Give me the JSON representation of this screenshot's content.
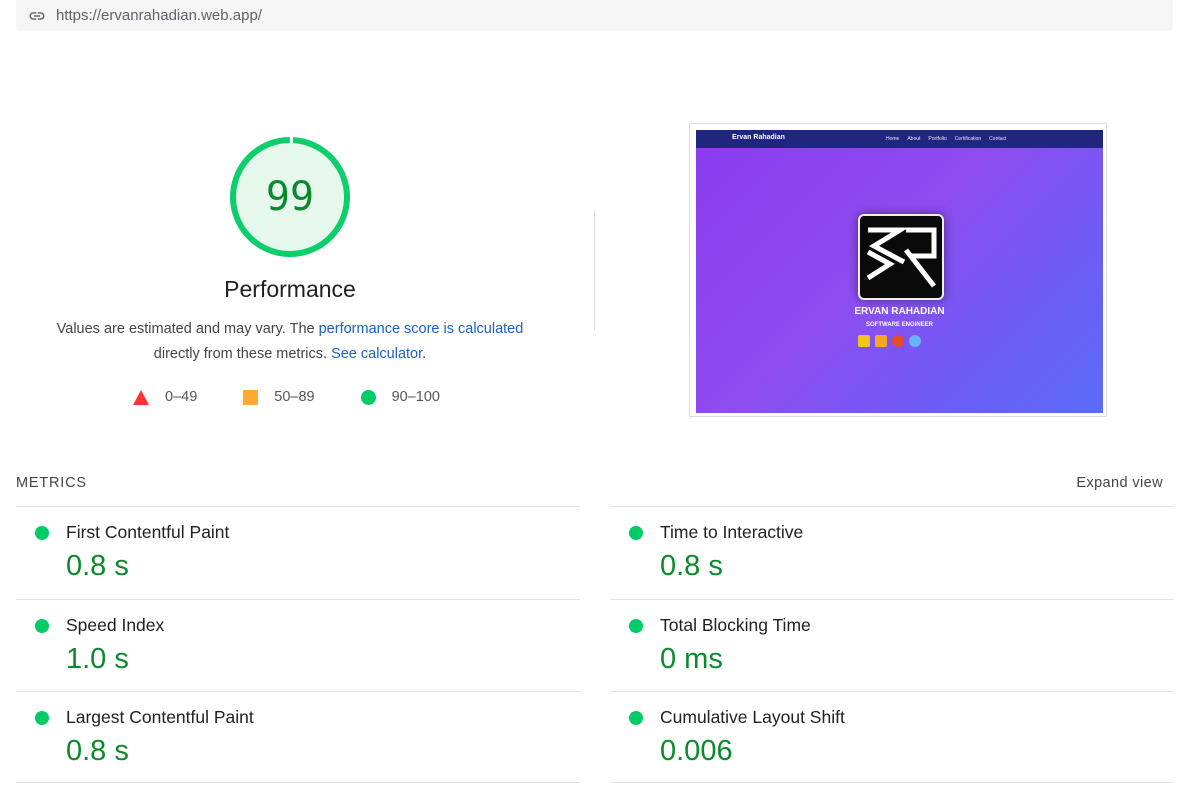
{
  "url_bar": {
    "icon": "link-icon",
    "url": "https://ervanrahadian.web.app/"
  },
  "gauge": {
    "score": "99",
    "score_fraction": 0.99,
    "title": "Performance",
    "desc_prefix": "Values are estimated and may vary. The ",
    "desc_link1": "performance score is calculated",
    "desc_middle": " directly from these metrics. ",
    "desc_link2": "See calculator",
    "desc_suffix": ".",
    "color": "#0cce6b",
    "score_text_color": "#0b8a2d"
  },
  "legend": [
    {
      "shape": "triangle",
      "color": "#ff3333",
      "label": "0–49"
    },
    {
      "shape": "square",
      "color": "#ffaa33",
      "label": "50–89"
    },
    {
      "shape": "circle",
      "color": "#00cc66",
      "label": "90–100"
    }
  ],
  "preview": {
    "brand": "Ervan Rahadian",
    "menu": [
      "Home",
      "About",
      "Portfolio",
      "Certification",
      "Contact"
    ],
    "name": "ERVAN RAHADIAN",
    "role": "SOFTWARE ENGINEER"
  },
  "metrics": {
    "header": "METRICS",
    "expand_label": "Expand view",
    "items": [
      {
        "label": "First Contentful Paint",
        "value": "0.8 s"
      },
      {
        "label": "Time to Interactive",
        "value": "0.8 s"
      },
      {
        "label": "Speed Index",
        "value": "1.0 s"
      },
      {
        "label": "Total Blocking Time",
        "value": "0 ms"
      },
      {
        "label": "Largest Contentful Paint",
        "value": "0.8 s"
      },
      {
        "label": "Cumulative Layout Shift",
        "value": "0.006"
      }
    ]
  }
}
